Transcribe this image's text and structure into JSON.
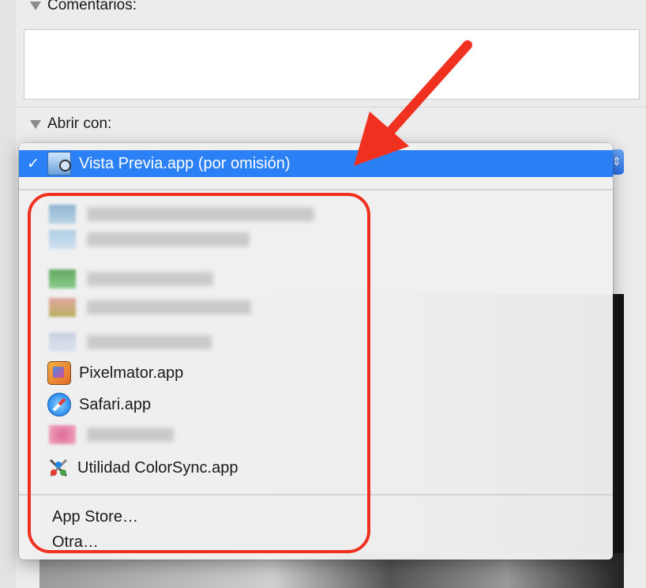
{
  "sections": {
    "comments_label": "Comentarios:",
    "open_with_label": "Abrir con:"
  },
  "menu": {
    "selected_item": {
      "check": "✓",
      "label": "Vista Previa.app (por omisión)",
      "icon": "preview-icon"
    },
    "apps": [
      {
        "label": "Pixelmator.app",
        "icon": "pixelmator-icon"
      },
      {
        "label": "Safari.app",
        "icon": "safari-icon"
      },
      {
        "label": "Utilidad ColorSync.app",
        "icon": "colorsync-icon"
      }
    ],
    "footer": [
      {
        "label": "App Store…"
      },
      {
        "label": "Otra…"
      }
    ]
  },
  "colors": {
    "selection": "#2a80f4",
    "annotation": "#f0311f"
  }
}
